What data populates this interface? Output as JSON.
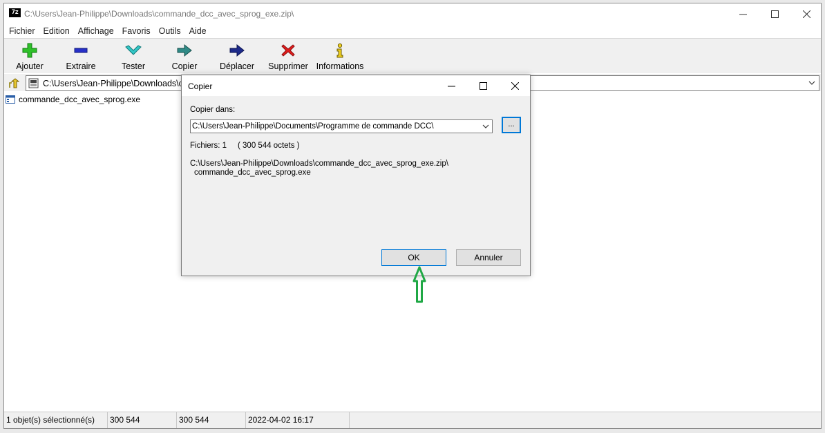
{
  "window": {
    "title": "C:\\Users\\Jean-Philippe\\Downloads\\commande_dcc_avec_sprog_exe.zip\\",
    "app_icon_text": "7z"
  },
  "menu": [
    "Fichier",
    "Edition",
    "Affichage",
    "Favoris",
    "Outils",
    "Aide"
  ],
  "toolbar": {
    "add": "Ajouter",
    "extract": "Extraire",
    "test": "Tester",
    "copy": "Copier",
    "move": "Déplacer",
    "delete": "Supprimer",
    "info": "Informations"
  },
  "address": {
    "path": "C:\\Users\\Jean-Philippe\\Downloads\\co"
  },
  "files": [
    {
      "name": "commande_dcc_avec_sprog.exe"
    }
  ],
  "status": {
    "selection": "1 objet(s) sélectionné(s)",
    "size": "300 544",
    "packed": "300 544",
    "modified": "2022-04-02 16:17"
  },
  "dialog": {
    "title": "Copier",
    "copy_to_label": "Copier dans:",
    "destination": "C:\\Users\\Jean-Philippe\\Documents\\Programme de commande DCC\\",
    "browse_label": "...",
    "files_info": "Fichiers: 1     ( 300 544 octets )",
    "source_path": "C:\\Users\\Jean-Philippe\\Downloads\\commande_dcc_avec_sprog_exe.zip\\",
    "source_file": "commande_dcc_avec_sprog.exe",
    "ok_label": "OK",
    "cancel_label": "Annuler"
  },
  "colors": {
    "accent": "#0078d7",
    "annotation": "#1fa845"
  }
}
